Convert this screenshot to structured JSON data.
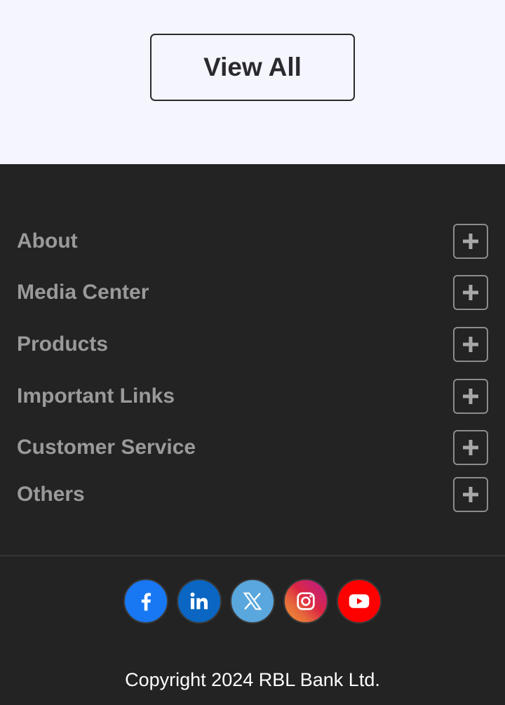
{
  "top": {
    "view_all_label": "View All"
  },
  "footer": {
    "accordion": [
      {
        "label": "About"
      },
      {
        "label": "Media Center"
      },
      {
        "label": "Products"
      },
      {
        "label": "Important Links"
      },
      {
        "label": "Customer Service"
      },
      {
        "label": "Others"
      }
    ],
    "social": [
      {
        "name": "facebook-icon",
        "color": "#1877f2"
      },
      {
        "name": "linkedin-icon",
        "color": "#0a66c2"
      },
      {
        "name": "x-twitter-icon",
        "color": "#5aa7de"
      },
      {
        "name": "instagram-icon",
        "color": "#d6336c"
      },
      {
        "name": "youtube-icon",
        "color": "#ff0000"
      }
    ],
    "copyright": "Copyright 2024 RBL Bank Ltd."
  }
}
